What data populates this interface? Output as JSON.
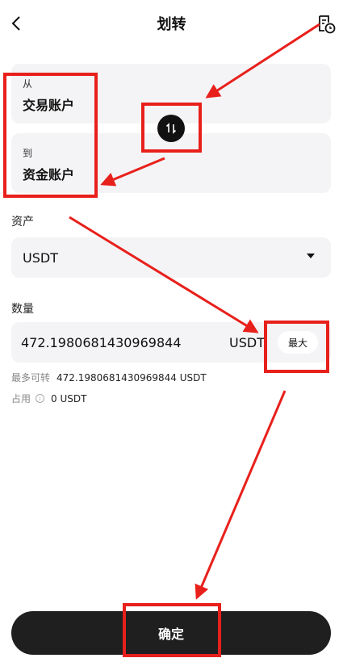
{
  "header": {
    "title": "划转",
    "back_icon": "chevron-left-icon",
    "history_icon": "transfer-history-icon"
  },
  "transfer": {
    "from_label": "从",
    "from_account": "交易账户",
    "to_label": "到",
    "to_account": "资金账户",
    "swap_icon": "swap-arrows-icon"
  },
  "asset": {
    "label": "资产",
    "selected": "USDT"
  },
  "quantity": {
    "label": "数量",
    "value": "472.1980681430969844",
    "unit": "USDT",
    "max_label": "最大",
    "max_transferable_label": "最多可转",
    "max_transferable_value": "472.1980681430969844 USDT",
    "occupied_label": "占用",
    "occupied_value": "0 USDT"
  },
  "confirm": {
    "label": "确定"
  },
  "colors": {
    "annotation_red": "#e8201c",
    "card_bg": "#f4f4f6",
    "button_dark": "#1f1f1f"
  }
}
